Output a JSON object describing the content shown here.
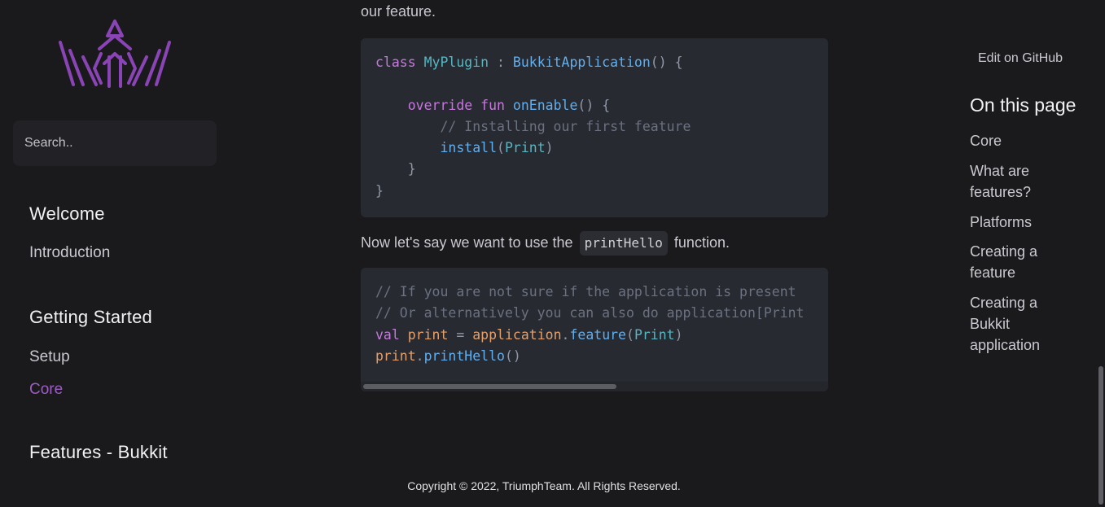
{
  "sidebar": {
    "search_placeholder": "Search..",
    "sections": [
      {
        "title": "Welcome",
        "items": [
          "Introduction"
        ]
      },
      {
        "title": "Getting Started",
        "items": [
          "Setup",
          "Core"
        ]
      },
      {
        "title": "Features - Bukkit"
      }
    ],
    "active_item": "Core"
  },
  "content": {
    "intro_text": "our feature.",
    "para_before": "Now let's say we want to use the",
    "inline_code": "printHello",
    "para_after": "function.",
    "code_block_1": [
      "class MyPlugin : BukkitApplication() {",
      "",
      "    override fun onEnable() {",
      "        // Installing our first feature",
      "        install(Print)",
      "    }",
      "}"
    ],
    "code_block_2": [
      "// If you are not sure if the application is present",
      "// Or alternatively you can also do application[Print",
      "val print = application.feature(Print)",
      "print.printHello()"
    ]
  },
  "footer": {
    "copyright": "Copyright © 2022, TriumphTeam. All Rights Reserved."
  },
  "toc": {
    "edit_label": "Edit on GitHub",
    "title": "On this page",
    "links": [
      "Core",
      "What are features?",
      "Platforms",
      "Creating a feature",
      "Creating a Bukkit application"
    ]
  },
  "colors": {
    "accent": "#9d5cc4",
    "background": "#1a1a1d",
    "code_bg": "#282a31"
  },
  "icons": {
    "logo": "triumph-crown-logo"
  }
}
